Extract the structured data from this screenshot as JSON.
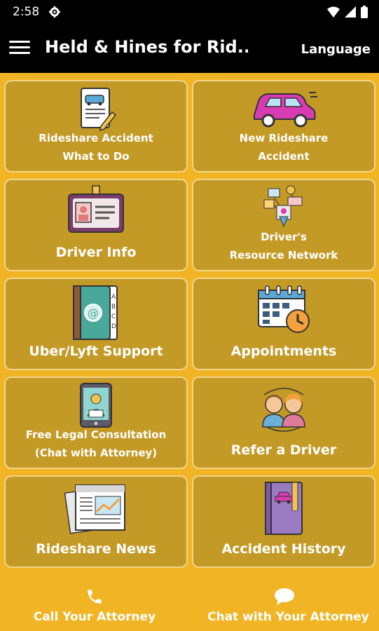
{
  "status": {
    "time": "2:58"
  },
  "header": {
    "title": "Held & Hines for Rid...",
    "language": "Language"
  },
  "tiles": [
    {
      "lines": [
        "Rideshare Accident",
        "What to Do"
      ],
      "icon": "document-car-icon"
    },
    {
      "lines": [
        "New Rideshare",
        "Accident"
      ],
      "icon": "taxi-car-icon"
    },
    {
      "label": "Driver Info",
      "icon": "id-card-icon"
    },
    {
      "lines": [
        "Driver's",
        "Resource Network"
      ],
      "icon": "network-icon"
    },
    {
      "label": "Uber/Lyft Support",
      "icon": "address-book-icon"
    },
    {
      "label": "Appointments",
      "icon": "calendar-clock-icon"
    },
    {
      "lines": [
        "Free Legal Consultation",
        "(Chat with Attorney)"
      ],
      "icon": "phone-attorney-icon"
    },
    {
      "label": "Refer a Driver",
      "icon": "people-icon"
    },
    {
      "label": "Rideshare News",
      "icon": "newspaper-icon"
    },
    {
      "label": "Accident History",
      "icon": "notebook-car-icon"
    }
  ],
  "bottom": {
    "call": "Call Your Attorney",
    "chat": "Chat with Your Attorney"
  }
}
